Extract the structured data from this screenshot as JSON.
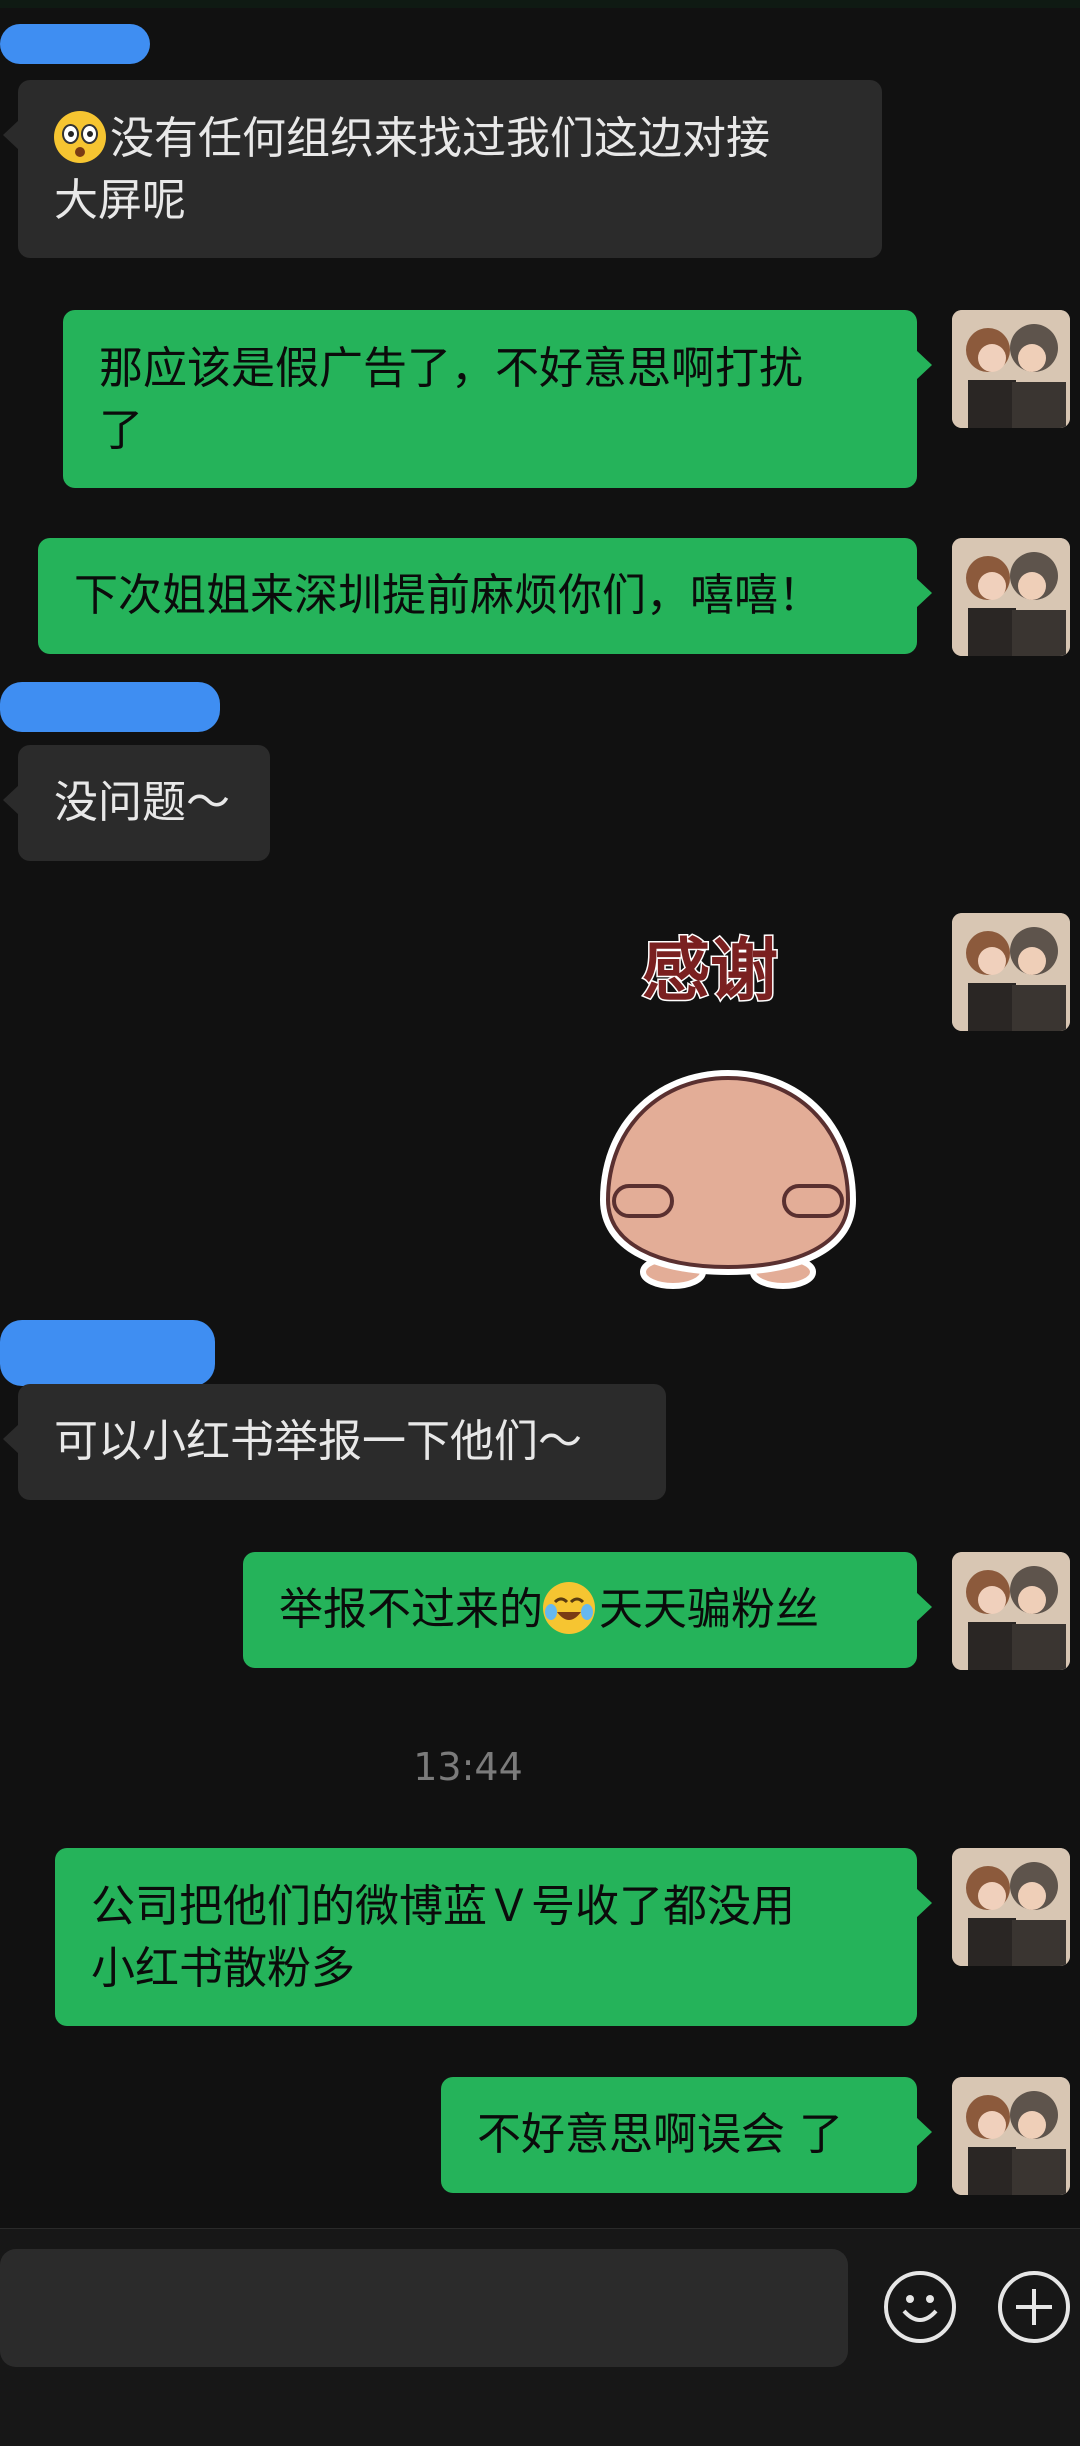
{
  "messages": [
    {
      "id": "m1",
      "side": "left",
      "text": "没有任何组织来找过我们这边对接大屏呢",
      "line1": "没有任何组织来找过我们这边对接",
      "line2": "大屏呢",
      "prefix_icon": "flushed-face-emoji"
    },
    {
      "id": "m2",
      "side": "right",
      "line1": "那应该是假广告了，不好意思啊打扰",
      "line2": "了"
    },
    {
      "id": "m3",
      "side": "right",
      "line1": "下次姐姐来深圳提前麻烦你们，嘻嘻！"
    },
    {
      "id": "m4",
      "side": "left",
      "line1": "没问题～"
    },
    {
      "id": "m5",
      "side": "right",
      "type": "sticker",
      "sticker_text": "感谢",
      "sticker_icon": "blob-thanks-sticker"
    },
    {
      "id": "m6",
      "side": "left",
      "line1": "可以小红书举报一下他们～"
    },
    {
      "id": "m7",
      "side": "right",
      "before": "举报不过来的",
      "emoji": "crying-laughing-emoji",
      "after": "天天骗粉丝"
    },
    {
      "id": "m8",
      "side": "right",
      "line1": "公司把他们的微博蓝Ｖ号收了都没用",
      "line2": "小红书散粉多"
    },
    {
      "id": "m9",
      "side": "right",
      "line1": "不好意思啊误会 了"
    }
  ],
  "timestamp": "13:44",
  "bottom_bar": {
    "emoji_icon": "emoji-button-icon",
    "plus_icon": "plus-button-icon"
  },
  "colors": {
    "background": "#111111",
    "incoming_bubble": "#2b2b2b",
    "outgoing_bubble": "#25b35a",
    "redaction": "#3f8ef2"
  }
}
